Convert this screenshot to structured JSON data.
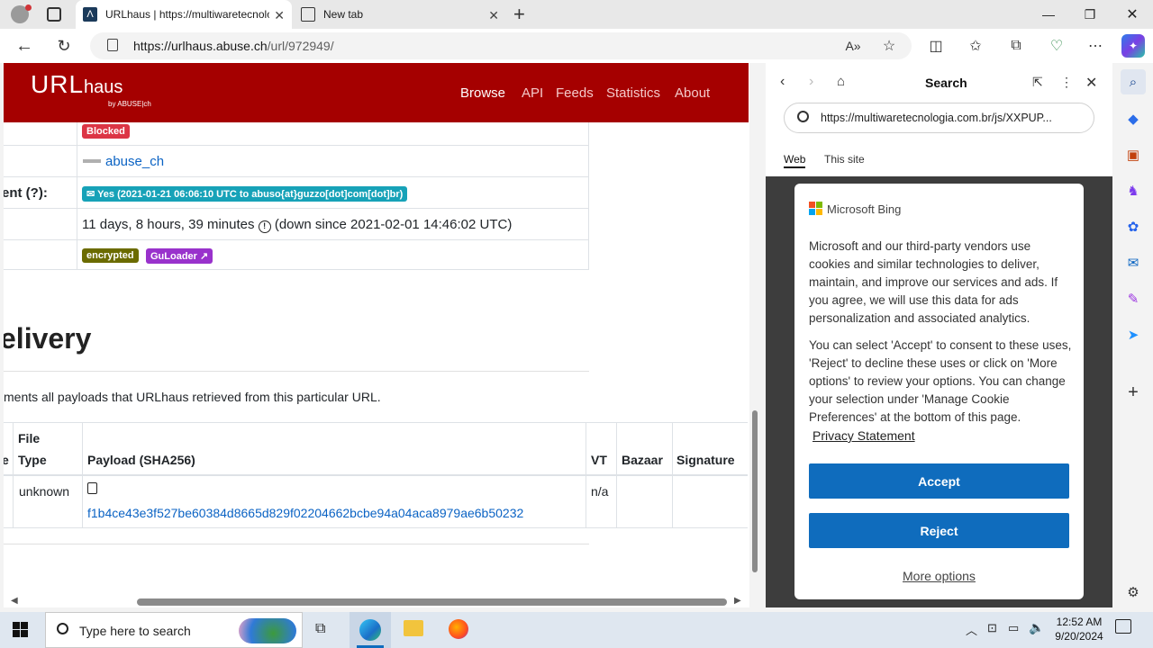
{
  "browser": {
    "tabs": [
      {
        "title": "URLhaus | https://multiwaretecnologia.com.br/js/XXPUP"
      },
      {
        "title": "New tab"
      }
    ],
    "url_host": "https://urlhaus.abuse.ch",
    "url_path": "/url/972949/",
    "window_controls": [
      "minimize",
      "restore",
      "close"
    ]
  },
  "site": {
    "logo_main": "URL",
    "logo_sub": "haus",
    "logo_by": "by ABUSE|ch",
    "nav": [
      "Browse",
      "API",
      "Feeds",
      "Statistics",
      "About"
    ]
  },
  "info_rows": {
    "status_badge": "Blocked",
    "reporter": "abuse_ch",
    "takedown_label": "ent (?):",
    "takedown_badge": "Yes (2021-01-21 06:06:10 UTC to abuso{at}guzzo[dot]com[dot]br)",
    "uptime_text": "11 days, 8 hours, 39 minutes",
    "uptime_down": "(down since 2021-02-01 14:46:02 UTC)",
    "tag1": "encrypted",
    "tag2": "GuLoader"
  },
  "section": {
    "heading": "elivery",
    "desc": "ments all payloads that URLhaus retrieved from this particular URL."
  },
  "payload_table": {
    "headers": [
      "e",
      "File Type",
      "Payload (SHA256)",
      "VT",
      "Bazaar",
      "Signature"
    ],
    "header_file": "File",
    "header_type": "Type",
    "row": {
      "file_type": "unknown",
      "sha256": "f1b4ce43e3f527be60384d8665d829f02204662bcbe94a04aca8979ae6b50232",
      "vt": "n/a"
    }
  },
  "side_panel": {
    "title": "Search",
    "search_value": "https://multiwaretecnologia.com.br/js/XXPUP...",
    "tab_web": "Web",
    "tab_site": "This site"
  },
  "cookie_dialog": {
    "brand": "Microsoft Bing",
    "para1": "Microsoft and our third-party vendors use cookies and similar technologies to deliver, maintain, and improve our services and ads. If you agree, we will use this data for ads personalization and associated analytics.",
    "para2": "You can select 'Accept' to consent to these uses, 'Reject' to decline these uses or click on 'More options' to review your options. You can change your selection under 'Manage Cookie Preferences' at the bottom of this page.",
    "privacy_link": "Privacy Statement",
    "accept": "Accept",
    "reject": "Reject",
    "more": "More options"
  },
  "taskbar": {
    "search_placeholder": "Type here to search",
    "time": "12:52 AM",
    "date": "9/20/2024"
  },
  "colors": {
    "header_red": "#a50000",
    "badge_red": "#dc3545",
    "badge_teal": "#17a2b8",
    "badge_olive": "#6b6b00",
    "badge_purple": "#9932cc",
    "link_blue": "#0f6cbd"
  }
}
